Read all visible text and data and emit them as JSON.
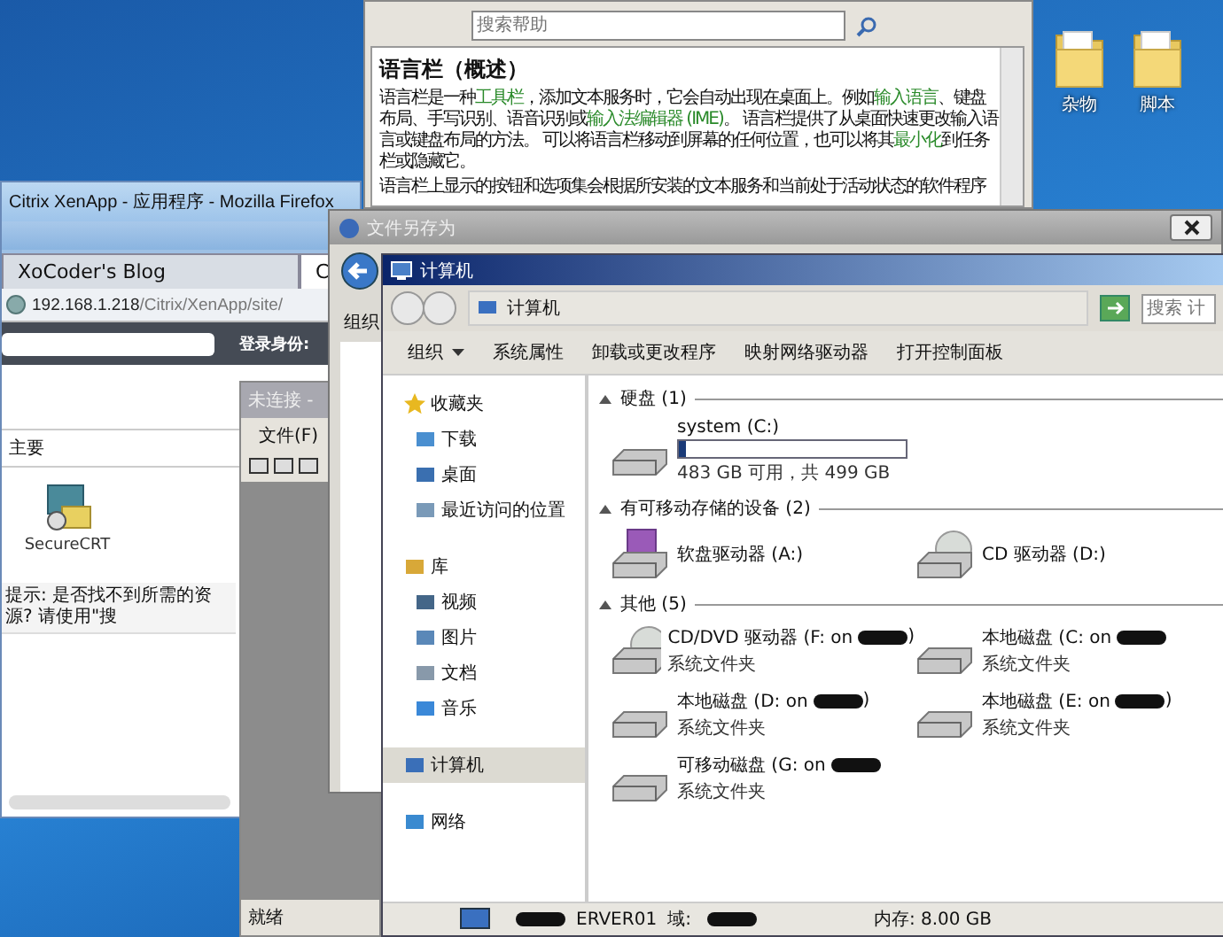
{
  "help_window": {
    "search": {
      "placeholder": "搜索帮助"
    },
    "heading": "语言栏（概述）",
    "paragraphs": [
      [
        {
          "text": "语言栏是一种",
          "link": false
        },
        {
          "text": "工具栏",
          "link": true
        },
        {
          "text": "，添加文本服务时，它会自动出现在桌面上。例如",
          "link": false
        },
        {
          "text": "输入语言",
          "link": true
        },
        {
          "text": "、键盘布局、手写识别、语音识别或",
          "link": false
        },
        {
          "text": "输入法编辑器 (IME)",
          "link": true
        },
        {
          "text": "。 语言栏提供了从桌面快速更改输入语言或键盘布局的方法。 可以将语言栏移动到屏幕的任何位置，也可以将其",
          "link": false
        },
        {
          "text": "最小化",
          "link": true
        },
        {
          "text": "到任务栏或隐藏它。",
          "link": false
        }
      ],
      [
        {
          "text": "语言栏上显示的按钮和选项集会根据所安装的文本服务和当前处于活动状态的软件程序",
          "link": false
        }
      ]
    ]
  },
  "desktop_icons": [
    {
      "label": "杂物"
    },
    {
      "label": "脚本"
    }
  ],
  "firefox": {
    "title": "Citrix XenApp - 应用程序 - Mozilla Firefox",
    "tabs": [
      {
        "label": "XoCoder's Blog",
        "selected": false
      },
      {
        "label": "C",
        "selected": true
      }
    ],
    "url": {
      "host": "192.168.1.218",
      "path": "/Citrix/XenApp/site/"
    },
    "login_label": "登录身份:",
    "section": "主要",
    "apps": [
      {
        "label": "SecureCRT"
      }
    ],
    "hint": "提示: 是否找不到所需的资源? 请使用\"搜"
  },
  "terminal_window": {
    "title": "未连接 -",
    "menu": [
      "文件(F)"
    ],
    "status": "就绪"
  },
  "save_dialog": {
    "title": "文件另存为",
    "toolbar_label": "组织"
  },
  "explorer": {
    "title": "计算机",
    "breadcrumb": "计算机",
    "search": {
      "placeholder": "搜索 计"
    },
    "toolbar": [
      {
        "label": "组织",
        "kind": "menu"
      },
      {
        "label": "系统属性",
        "kind": "command"
      },
      {
        "label": "卸载或更改程序",
        "kind": "command"
      },
      {
        "label": "映射网络驱动器",
        "kind": "command"
      },
      {
        "label": "打开控制面板",
        "kind": "command"
      }
    ],
    "nav": [
      {
        "label": "收藏夹",
        "kind": "star",
        "selected": false,
        "children": [
          {
            "label": "下载",
            "kind": "download",
            "selected": false
          },
          {
            "label": "桌面",
            "kind": "desktop",
            "selected": false
          },
          {
            "label": "最近访问的位置",
            "kind": "recent",
            "selected": false
          }
        ]
      },
      {
        "label": "库",
        "kind": "library",
        "selected": false,
        "children": [
          {
            "label": "视频",
            "kind": "video",
            "selected": false
          },
          {
            "label": "图片",
            "kind": "picture",
            "selected": false
          },
          {
            "label": "文档",
            "kind": "document",
            "selected": false
          },
          {
            "label": "音乐",
            "kind": "music",
            "selected": false
          }
        ]
      },
      {
        "label": "计算机",
        "kind": "computer",
        "selected": true
      },
      {
        "label": "网络",
        "kind": "network",
        "selected": false
      }
    ],
    "groups": [
      {
        "title": "硬盘 (1)",
        "items": [
          {
            "name": "system (C:)",
            "kind": "disk",
            "level": 0.032,
            "detail": "483 GB 可用，共 499 GB"
          }
        ]
      },
      {
        "title": "有可移动存储的设备 (2)",
        "items": [
          {
            "name": "软盘驱动器 (A:)",
            "kind": "floppy"
          },
          {
            "name": "CD 驱动器 (D:)",
            "kind": "cd"
          }
        ]
      },
      {
        "title": "其他 (5)",
        "items": [
          {
            "name": "CD/DVD 驱动器 (F: on",
            "kind": "cd",
            "redacted": true,
            "suffix": ")",
            "detail": "系统文件夹"
          },
          {
            "name": "本地磁盘 (C: on",
            "kind": "local",
            "redacted": true,
            "detail": "系统文件夹"
          },
          {
            "name": "本地磁盘 (D: on",
            "kind": "local",
            "redacted": true,
            "suffix": ")",
            "detail": "系统文件夹"
          },
          {
            "name": "本地磁盘 (E: on",
            "kind": "local",
            "redacted": true,
            "suffix": ")",
            "detail": "系统文件夹"
          },
          {
            "name": "可移动磁盘 (G: on",
            "kind": "local",
            "redacted": true,
            "detail": "系统文件夹"
          }
        ]
      }
    ],
    "details": {
      "computer": "ERVER01",
      "domain_label": "域:",
      "memory": "内存: 8.00 GB"
    }
  }
}
